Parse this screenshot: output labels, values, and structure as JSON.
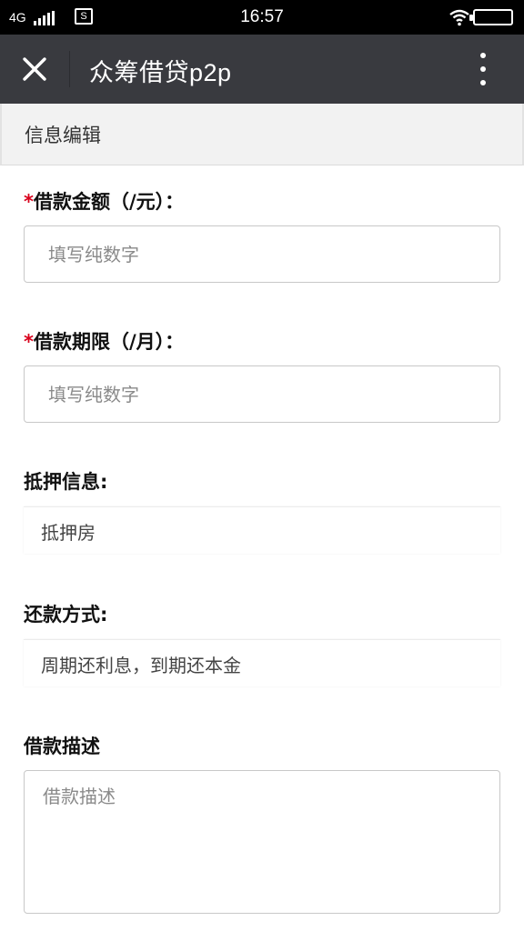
{
  "status_bar": {
    "network": "4G",
    "sim_icon": "S",
    "time": "16:57"
  },
  "title_bar": {
    "title": "众筹借贷p2p"
  },
  "section": {
    "title": "信息编辑"
  },
  "form": {
    "loan_amount": {
      "required_mark": "*",
      "label": "借款金额（/元）：",
      "placeholder": "填写纯数字"
    },
    "loan_term": {
      "required_mark": "*",
      "label": "借款期限（/月）：",
      "placeholder": "填写纯数字"
    },
    "collateral": {
      "label": "抵押信息:",
      "value": "抵押房"
    },
    "repayment": {
      "label": "还款方式:",
      "value": "周期还利息，到期还本金"
    },
    "description": {
      "label": "借款描述",
      "placeholder": "借款描述"
    }
  },
  "colors": {
    "title_bar_bg": "#393a3f",
    "required_mark": "#d9001b",
    "section_bg": "#f2f2f2"
  }
}
